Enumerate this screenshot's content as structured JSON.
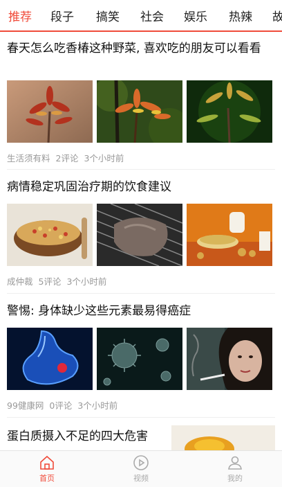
{
  "tabs": [
    "推荐",
    "段子",
    "搞笑",
    "社会",
    "娱乐",
    "热辣",
    "故"
  ],
  "active_tab": 0,
  "articles": [
    {
      "title": "春天怎么吃香椿这种野菜, 喜欢吃的朋友可以看看",
      "source": "生活须有料",
      "comments": "2评论",
      "time": "3个小时前"
    },
    {
      "title": "病情稳定巩固治疗期的饮食建议",
      "source": "成仲裁",
      "comments": "5评论",
      "time": "3个小时前"
    },
    {
      "title": "警惕: 身体缺少这些元素最易得癌症",
      "source": "99健康网",
      "comments": "0评论",
      "time": "3个小时前"
    },
    {
      "title": "蛋白质摄入不足的四大危害"
    }
  ],
  "bottom_nav": [
    {
      "label": "首页",
      "icon": "home-icon",
      "active": true
    },
    {
      "label": "视频",
      "icon": "play-icon",
      "active": false
    },
    {
      "label": "我的",
      "icon": "person-icon",
      "active": false
    }
  ],
  "colors": {
    "accent": "#f04b3a",
    "meta": "#999999"
  }
}
